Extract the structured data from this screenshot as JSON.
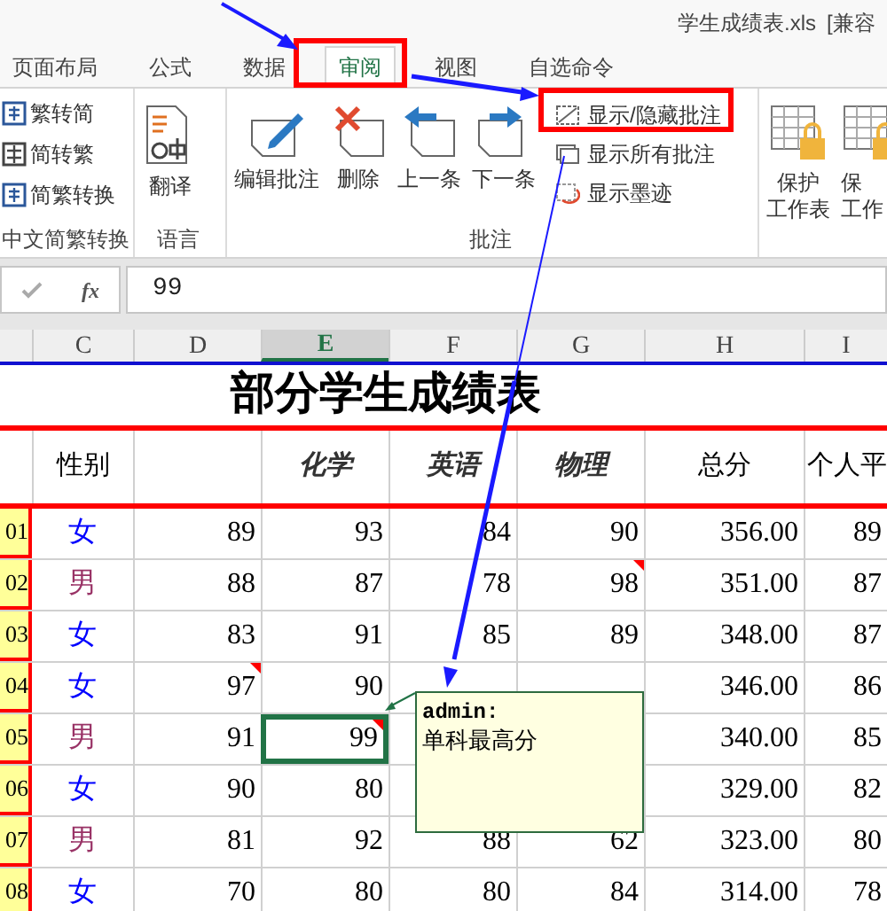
{
  "window": {
    "title": "学生成绩表.xls",
    "mode": "[兼容"
  },
  "tabs": [
    {
      "label": "页面布局",
      "selected": false
    },
    {
      "label": "公式",
      "selected": false
    },
    {
      "label": "数据",
      "selected": false
    },
    {
      "label": "审阅",
      "selected": true
    },
    {
      "label": "视图",
      "selected": false
    },
    {
      "label": "自选命令",
      "selected": false
    }
  ],
  "ribbon": {
    "groups": [
      {
        "label": "中文简繁转换",
        "items": [
          {
            "kind": "small",
            "label": "繁转简"
          },
          {
            "kind": "small",
            "label": "简转繁"
          },
          {
            "kind": "small",
            "label": "简繁转换"
          }
        ]
      },
      {
        "label": "语言",
        "items": [
          {
            "kind": "large",
            "label": "翻译"
          }
        ]
      },
      {
        "label": "批注",
        "items": [
          {
            "kind": "large",
            "label": "编辑批注"
          },
          {
            "kind": "large",
            "label": "删除"
          },
          {
            "kind": "large",
            "label": "上一条"
          },
          {
            "kind": "large",
            "label": "下一条"
          },
          {
            "kind": "stack",
            "buttons": [
              {
                "label": "显示/隐藏批注"
              },
              {
                "label": "显示所有批注"
              },
              {
                "label": "显示墨迹"
              }
            ]
          }
        ]
      },
      {
        "items": [
          {
            "kind": "large",
            "label": "保护",
            "label2": "工作表"
          },
          {
            "kind": "large",
            "label": "保",
            "label2": "工作"
          }
        ]
      }
    ]
  },
  "formula_bar": {
    "fx": "fx",
    "value": "99"
  },
  "columns": [
    {
      "label": "C",
      "selected": false
    },
    {
      "label": "D",
      "selected": false
    },
    {
      "label": "E",
      "selected": true
    },
    {
      "label": "F",
      "selected": false
    },
    {
      "label": "G",
      "selected": false
    },
    {
      "label": "H",
      "selected": false
    },
    {
      "label": "I",
      "selected": false
    }
  ],
  "sheet_title": "部分学生成绩表",
  "headers": [
    {
      "text": "性别",
      "italic": false
    },
    {
      "text": "化学",
      "italic": true
    },
    {
      "text": "英语",
      "italic": true
    },
    {
      "text": "物理",
      "italic": true
    },
    {
      "text": "总分",
      "italic": false
    },
    {
      "text": "个人平",
      "italic": false
    }
  ],
  "rows": [
    {
      "row": "01",
      "gender": {
        "text": "女",
        "color": "#0000ff"
      },
      "cells": [
        {
          "text": "89",
          "comment": false,
          "selected": false
        },
        {
          "text": "93",
          "comment": false,
          "selected": false
        },
        {
          "text": "84",
          "comment": false,
          "selected": false
        },
        {
          "text": "90",
          "comment": false,
          "selected": false
        },
        {
          "text": "356.00",
          "comment": false,
          "selected": false
        },
        {
          "text": "89",
          "comment": false,
          "selected": false
        }
      ]
    },
    {
      "row": "02",
      "gender": {
        "text": "男",
        "color": "#993366"
      },
      "cells": [
        {
          "text": "88",
          "comment": false,
          "selected": false
        },
        {
          "text": "87",
          "comment": false,
          "selected": false
        },
        {
          "text": "78",
          "comment": false,
          "selected": false
        },
        {
          "text": "98",
          "comment": true,
          "selected": false
        },
        {
          "text": "351.00",
          "comment": false,
          "selected": false
        },
        {
          "text": "87",
          "comment": false,
          "selected": false
        }
      ]
    },
    {
      "row": "03",
      "gender": {
        "text": "女",
        "color": "#0000ff"
      },
      "cells": [
        {
          "text": "83",
          "comment": false,
          "selected": false
        },
        {
          "text": "91",
          "comment": false,
          "selected": false
        },
        {
          "text": "85",
          "comment": false,
          "selected": false
        },
        {
          "text": "89",
          "comment": false,
          "selected": false
        },
        {
          "text": "348.00",
          "comment": false,
          "selected": false
        },
        {
          "text": "87",
          "comment": false,
          "selected": false
        }
      ]
    },
    {
      "row": "04",
      "gender": {
        "text": "女",
        "color": "#0000ff"
      },
      "cells": [
        {
          "text": "97",
          "comment": true,
          "selected": false
        },
        {
          "text": "90",
          "comment": false,
          "selected": false
        },
        null,
        null,
        {
          "text": "346.00",
          "comment": false,
          "selected": false
        },
        {
          "text": "86",
          "comment": false,
          "selected": false
        }
      ]
    },
    {
      "row": "05",
      "gender": {
        "text": "男",
        "color": "#993366"
      },
      "cells": [
        {
          "text": "91",
          "comment": false,
          "selected": false
        },
        {
          "text": "99",
          "comment": true,
          "selected": true
        },
        null,
        null,
        {
          "text": "340.00",
          "comment": false,
          "selected": false
        },
        {
          "text": "85",
          "comment": false,
          "selected": false
        }
      ]
    },
    {
      "row": "06",
      "gender": {
        "text": "女",
        "color": "#0000ff"
      },
      "cells": [
        {
          "text": "90",
          "comment": false,
          "selected": false
        },
        {
          "text": "80",
          "comment": false,
          "selected": false
        },
        null,
        null,
        {
          "text": "329.00",
          "comment": false,
          "selected": false
        },
        {
          "text": "82",
          "comment": false,
          "selected": false
        }
      ]
    },
    {
      "row": "07",
      "gender": {
        "text": "男",
        "color": "#993366"
      },
      "cells": [
        {
          "text": "81",
          "comment": false,
          "selected": false
        },
        {
          "text": "92",
          "comment": false,
          "selected": false
        },
        {
          "text": "88",
          "comment": false,
          "selected": false
        },
        {
          "text": "62",
          "comment": false,
          "selected": false
        },
        {
          "text": "323.00",
          "comment": false,
          "selected": false
        },
        {
          "text": "80",
          "comment": false,
          "selected": false
        }
      ]
    },
    {
      "row": "08",
      "gender": {
        "text": "女",
        "color": "#0000ff"
      },
      "cells": [
        {
          "text": "70",
          "comment": false,
          "selected": false
        },
        {
          "text": "80",
          "comment": false,
          "selected": false
        },
        {
          "text": "80",
          "comment": false,
          "selected": false
        },
        {
          "text": "84",
          "comment": false,
          "selected": false
        },
        {
          "text": "314.00",
          "comment": false,
          "selected": false
        },
        {
          "text": "78",
          "comment": false,
          "selected": false
        }
      ]
    }
  ],
  "comment": {
    "author": "admin:",
    "text": "单科最高分"
  }
}
